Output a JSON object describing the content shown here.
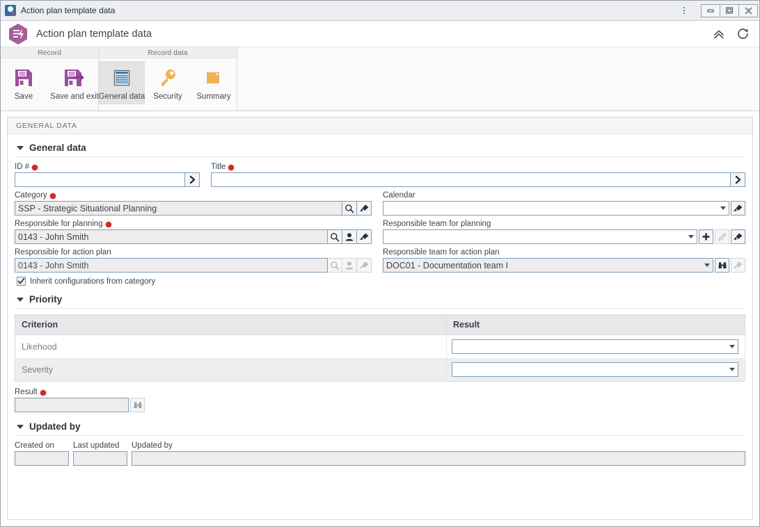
{
  "window": {
    "title": "Action plan template data",
    "app_icon": "app-logo-icon",
    "controls": {
      "menu": "kebab-menu-icon",
      "minimize": "minimize-icon",
      "maximize": "maximize-icon",
      "close": "close-icon"
    }
  },
  "header": {
    "title": "Action plan template data",
    "logo": "hexagon-lightning-logo",
    "collapse_icon": "double-chevron-up-icon",
    "refresh_icon": "refresh-icon"
  },
  "ribbon": {
    "groups": [
      {
        "label": "Record",
        "items": [
          {
            "label": "Save",
            "icon": "floppy-save-icon",
            "selected": false
          },
          {
            "label": "Save and exit",
            "icon": "floppy-save-exit-icon",
            "selected": false
          }
        ]
      },
      {
        "label": "Record data",
        "items": [
          {
            "label": "General data",
            "icon": "document-lines-icon",
            "selected": true
          },
          {
            "label": "Security",
            "icon": "key-icon",
            "selected": false
          },
          {
            "label": "Summary",
            "icon": "folder-page-icon",
            "selected": false
          }
        ]
      }
    ]
  },
  "panel": {
    "breadcrumb": "GENERAL DATA",
    "sections": {
      "general": {
        "title": "General data",
        "fields": {
          "id": {
            "label": "ID #",
            "required": true,
            "value": "",
            "button_icon": "chevron-right-icon"
          },
          "title": {
            "label": "Title",
            "required": true,
            "value": "",
            "button_icon": "chevron-right-icon"
          },
          "category": {
            "label": "Category",
            "required": true,
            "value": "SSP - Strategic Situational Planning",
            "buttons": [
              "magnifier-icon",
              "brush-icon"
            ]
          },
          "calendar": {
            "label": "Calendar",
            "required": false,
            "value": "",
            "buttons": [
              "brush-icon"
            ]
          },
          "responsible_planning": {
            "label": "Responsible for planning",
            "required": true,
            "value": "0143 - John Smith",
            "buttons": [
              "magnifier-icon",
              "person-icon",
              "brush-icon"
            ]
          },
          "responsible_team_planning": {
            "label": "Responsible team for planning",
            "required": false,
            "value": "",
            "buttons": [
              "plus-icon",
              "pencil-icon",
              "brush-icon"
            ]
          },
          "responsible_action_plan": {
            "label": "Responsible for action plan",
            "required": false,
            "value": "0143 - John Smith",
            "buttons": [
              "magnifier-icon",
              "person-icon",
              "brush-icon"
            ]
          },
          "responsible_team_action_plan": {
            "label": "Responsible team for action plan",
            "required": false,
            "value": "DOC01 - Documentation team I",
            "buttons": [
              "binoculars-icon",
              "brush-icon"
            ]
          },
          "inherit": {
            "label": "Inherit configurations from category",
            "checked": true
          }
        }
      },
      "priority": {
        "title": "Priority",
        "table": {
          "columns": [
            "Criterion",
            "Result"
          ],
          "rows": [
            {
              "criterion": "Likehood",
              "result": ""
            },
            {
              "criterion": "Severity",
              "result": ""
            }
          ]
        },
        "result": {
          "label": "Result",
          "required": true,
          "value": "",
          "button_icon": "binoculars-icon"
        }
      },
      "updated_by": {
        "title": "Updated by",
        "fields": [
          {
            "label": "Created on",
            "value": ""
          },
          {
            "label": "Last updated",
            "value": ""
          },
          {
            "label": "Updated by",
            "value": ""
          }
        ]
      }
    }
  },
  "colors": {
    "accent_purple": "#a85c9a",
    "required_red": "#d42b1e",
    "key_orange": "#efb257",
    "doc_blue": "#3b7cb5",
    "input_border": "#7f9db9"
  }
}
